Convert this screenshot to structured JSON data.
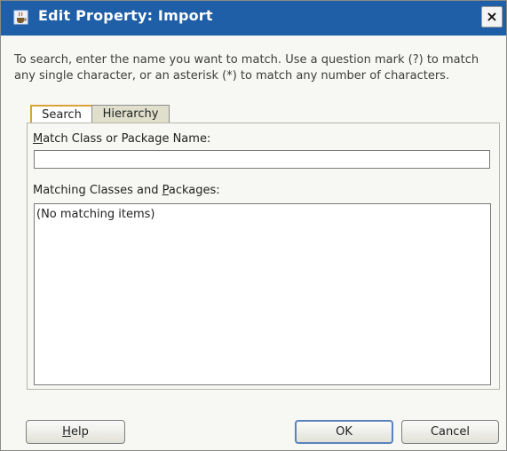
{
  "dialog": {
    "title": "Edit Property: Import",
    "close_label": "×",
    "intro_line1": "To search, enter the name you want to match. Use a question mark (?) to match",
    "intro_line2": "any single character, or an asterisk (*) to match any number of characters."
  },
  "tabs": [
    {
      "label": "Search",
      "selected": true
    },
    {
      "label": "Hierarchy",
      "selected": false
    }
  ],
  "search": {
    "match_label_pre": "",
    "match_label_mn": "M",
    "match_label_post": "atch Class or Package Name:",
    "match_value": "",
    "results_label_pre": "Matching Classes and ",
    "results_label_mn": "P",
    "results_label_post": "ackages:",
    "results_empty": "(No matching items)"
  },
  "buttons": {
    "help_pre": "",
    "help_mn": "H",
    "help_post": "elp",
    "ok": "OK",
    "cancel": "Cancel"
  },
  "colors": {
    "titlebar": "#1f5fa8",
    "tab_focus": "#d9a33a",
    "default_button_border": "#5a82bd"
  },
  "icons": {
    "title_icon": "java-coffee-icon",
    "close": "close-icon"
  }
}
